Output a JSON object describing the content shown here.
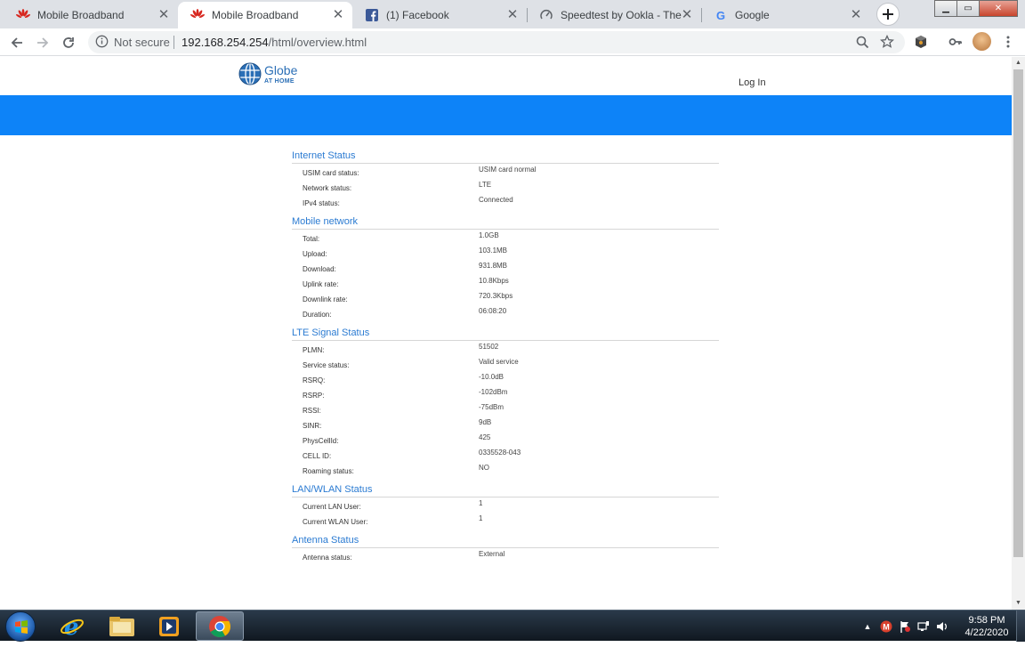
{
  "browser": {
    "tabs": [
      {
        "title": "Mobile Broadband",
        "icon": "huawei-icon",
        "active": false
      },
      {
        "title": "Mobile Broadband",
        "icon": "huawei-icon",
        "active": true
      },
      {
        "title": "(1) Facebook",
        "icon": "facebook-icon",
        "active": false
      },
      {
        "title": "Speedtest by Ookla - The Gl",
        "icon": "speedtest-icon",
        "active": false
      },
      {
        "title": "Google",
        "icon": "google-icon",
        "active": false
      }
    ],
    "security_label": "Not secure",
    "url_host": "192.168.254.254",
    "url_path": "/html/overview.html"
  },
  "header": {
    "logo_name": "Globe",
    "logo_sub": "AT HOME",
    "login_label": "Log In"
  },
  "sections": [
    {
      "title": "Internet Status",
      "rows": [
        {
          "label": "USIM card status:",
          "value": "USIM card normal"
        },
        {
          "label": "Network status:",
          "value": "LTE"
        },
        {
          "label": "IPv4 status:",
          "value": "Connected"
        }
      ]
    },
    {
      "title": "Mobile network",
      "rows": [
        {
          "label": "Total:",
          "value": "1.0GB"
        },
        {
          "label": "Upload:",
          "value": "103.1MB"
        },
        {
          "label": "Download:",
          "value": "931.8MB"
        },
        {
          "label": "Uplink rate:",
          "value": "10.8Kbps"
        },
        {
          "label": "Downlink rate:",
          "value": "720.3Kbps"
        },
        {
          "label": "Duration:",
          "value": "06:08:20"
        }
      ]
    },
    {
      "title": "LTE Signal Status",
      "rows": [
        {
          "label": "PLMN:",
          "value": "51502"
        },
        {
          "label": "Service status:",
          "value": "Valid service"
        },
        {
          "label": "RSRQ:",
          "value": "-10.0dB"
        },
        {
          "label": "RSRP:",
          "value": "-102dBm"
        },
        {
          "label": "RSSI:",
          "value": "-75dBm"
        },
        {
          "label": "SINR:",
          "value": "9dB"
        },
        {
          "label": "PhysCellId:",
          "value": "425"
        },
        {
          "label": "CELL ID:",
          "value": "0335528-043"
        },
        {
          "label": "Roaming status:",
          "value": "NO"
        }
      ]
    },
    {
      "title": "LAN/WLAN Status",
      "rows": [
        {
          "label": "Current LAN User:",
          "value": "1"
        },
        {
          "label": "Current WLAN User:",
          "value": "1"
        }
      ]
    },
    {
      "title": "Antenna Status",
      "rows": [
        {
          "label": "Antenna status:",
          "value": "External"
        }
      ]
    }
  ],
  "taskbar": {
    "time": "9:58 PM",
    "date": "4/22/2020"
  },
  "colors": {
    "brand_blue": "#0d83f8",
    "section_title": "#2b7bd2"
  }
}
